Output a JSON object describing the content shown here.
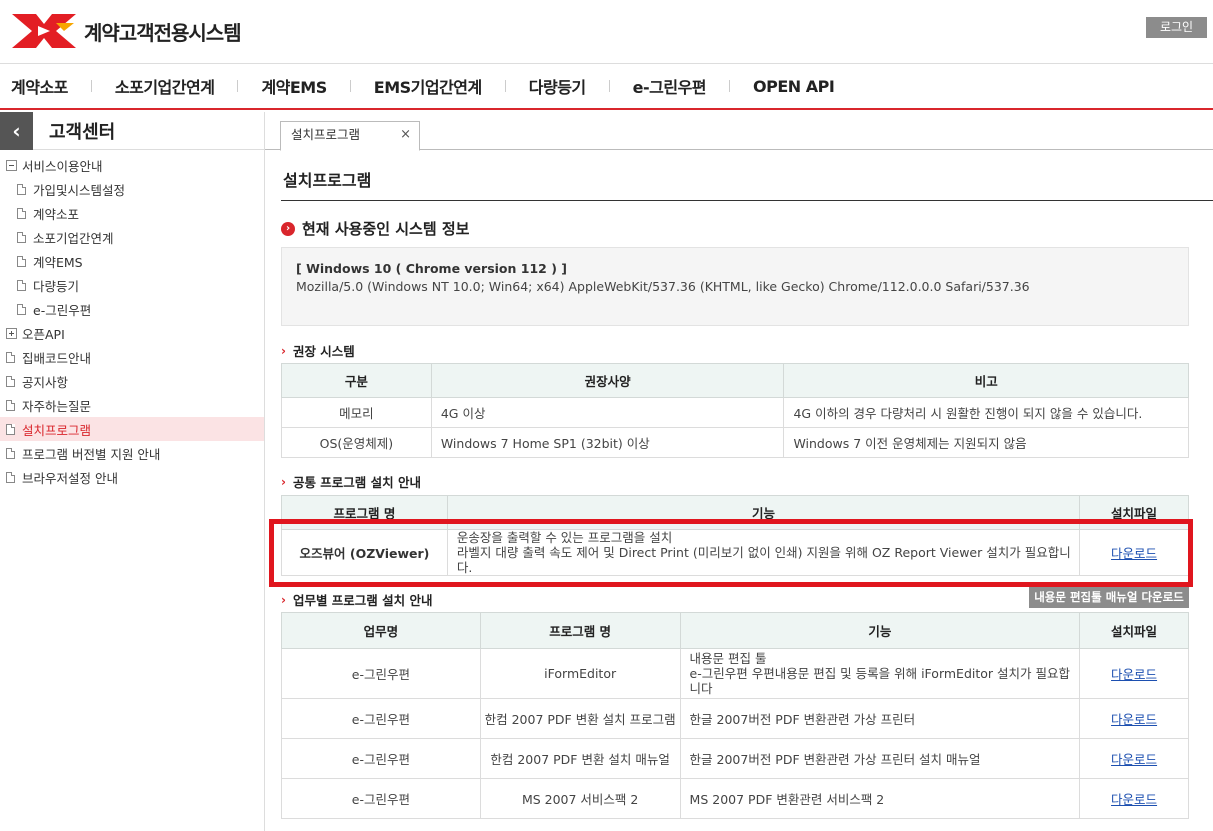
{
  "header": {
    "brand": "계약고객전용시스템",
    "login_label": "로그인"
  },
  "gnb": [
    "계약소포",
    "소포기업간연계",
    "계약EMS",
    "EMS기업간연계",
    "다량등기",
    "e-그린우편",
    "OPEN API"
  ],
  "sidebar": {
    "title": "고객센터",
    "items": [
      {
        "label": "서비스이용안내",
        "level": 0,
        "kind": "minus"
      },
      {
        "label": "가입및시스템설정",
        "level": 1,
        "kind": "doc"
      },
      {
        "label": "계약소포",
        "level": 1,
        "kind": "doc"
      },
      {
        "label": "소포기업간연계",
        "level": 1,
        "kind": "doc"
      },
      {
        "label": "계약EMS",
        "level": 1,
        "kind": "doc"
      },
      {
        "label": "다량등기",
        "level": 1,
        "kind": "doc"
      },
      {
        "label": "e-그린우편",
        "level": 1,
        "kind": "doc"
      },
      {
        "label": "오픈API",
        "level": 0,
        "kind": "plus"
      },
      {
        "label": "집배코드안내",
        "level": 0,
        "kind": "doc"
      },
      {
        "label": "공지사항",
        "level": 0,
        "kind": "doc"
      },
      {
        "label": "자주하는질문",
        "level": 0,
        "kind": "doc"
      },
      {
        "label": "설치프로그램",
        "level": 0,
        "kind": "doc",
        "active": true
      },
      {
        "label": "프로그램 버전별 지원 안내",
        "level": 0,
        "kind": "doc"
      },
      {
        "label": "브라우저설정 안내",
        "level": 0,
        "kind": "doc"
      }
    ]
  },
  "tab": {
    "label": "설치프로그램",
    "close": "×"
  },
  "page_title": "설치프로그램",
  "system_info": {
    "heading": "현재 사용중인 시스템 정보",
    "line1": "[ Windows 10 ( Chrome version 112 ) ]",
    "line2": "Mozilla/5.0 (Windows NT 10.0; Win64; x64) AppleWebKit/537.36 (KHTML, like Gecko) Chrome/112.0.0.0 Safari/537.36"
  },
  "recommended": {
    "heading": "권장 시스템",
    "headers": [
      "구분",
      "권장사양",
      "비고"
    ],
    "rows": [
      [
        "메모리",
        "4G 이상",
        "4G 이하의 경우 다량처리 시 원활한 진행이 되지 않을 수 있습니다."
      ],
      [
        "OS(운영체제)",
        "Windows 7 Home SP1 (32bit) 이상",
        "Windows 7 이전 운영체제는 지원되지 않음"
      ]
    ]
  },
  "common": {
    "heading": "공통 프로그램 설치 안내",
    "headers": [
      "프로그램 명",
      "기능",
      "설치파일"
    ],
    "rows": [
      {
        "name": "오즈뷰어 (OZViewer)",
        "desc1": "운송장을 출력할 수 있는 프로그램을 설치",
        "desc2": "라벨지 대량 출력 속도 제어 및 Direct Print (미리보기 없이 인쇄) 지원을 위해 OZ Report Viewer 설치가 필요합니다.",
        "link": "다운로드"
      }
    ]
  },
  "business": {
    "heading": "업무별 프로그램 설치 안내",
    "manual_button": "내용문 편집툴 매뉴얼 다운로드",
    "headers": [
      "업무명",
      "프로그램 명",
      "기능",
      "설치파일"
    ],
    "rows": [
      {
        "biz": "e-그린우편",
        "prog": "iFormEditor",
        "desc1": "내용문 편집 툴",
        "desc2": "e-그린우편 우편내용문 편집 및 등록을 위해 iFormEditor 설치가 필요합니다",
        "link": "다운로드"
      },
      {
        "biz": "e-그린우편",
        "prog": "한컴 2007 PDF 변환 설치 프로그램",
        "desc1": "한글 2007버전 PDF 변환관련 가상 프린터",
        "desc2": "",
        "link": "다운로드"
      },
      {
        "biz": "e-그린우편",
        "prog": "한컴 2007 PDF 변환 설치 매뉴얼",
        "desc1": "한글 2007버전 PDF 변환관련 가상 프린터 설치 매뉴얼",
        "desc2": "",
        "link": "다운로드"
      },
      {
        "biz": "e-그린우편",
        "prog": "MS 2007 서비스팩 2",
        "desc1": "MS 2007 PDF 변환관련 서비스팩 2",
        "desc2": "",
        "link": "다운로드"
      }
    ]
  },
  "colors": {
    "accent": "#d9262c",
    "header_bg": "#eef5f3",
    "highlight": "#e0161e"
  }
}
